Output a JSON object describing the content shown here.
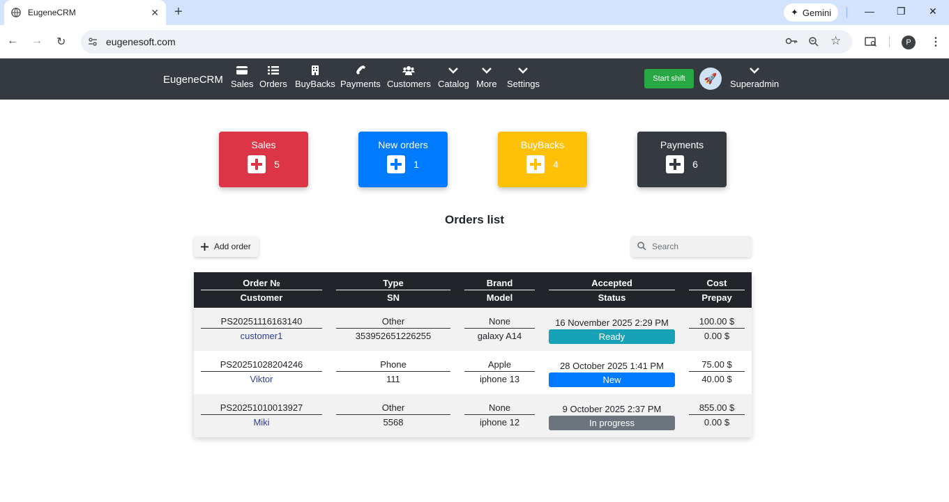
{
  "browser": {
    "tab_title": "EugeneCRM",
    "gemini_label": "Gemini",
    "url": "eugenesoft.com",
    "profile_initial": "P"
  },
  "navbar": {
    "brand": "EugeneCRM",
    "items": [
      {
        "label": "Sales",
        "icon": "card-icon"
      },
      {
        "label": "Orders",
        "icon": "list-icon"
      },
      {
        "label": "BuyBacks",
        "icon": "building-icon"
      },
      {
        "label": "Payments",
        "icon": "phone-icon"
      },
      {
        "label": "Customers",
        "icon": "users-icon"
      },
      {
        "label": "Catalog",
        "icon": "chevron-down-icon"
      },
      {
        "label": "More",
        "icon": "chevron-down-icon"
      },
      {
        "label": "Settings",
        "icon": "chevron-down-icon"
      }
    ],
    "start_shift": "Start shift",
    "user": "Superadmin"
  },
  "cards": [
    {
      "title": "Sales",
      "count": "5",
      "color": "#dc3545"
    },
    {
      "title": "New orders",
      "count": "1",
      "color": "#007bff"
    },
    {
      "title": "BuyBacks",
      "count": "4",
      "color": "#ffc107"
    },
    {
      "title": "Payments",
      "count": "6",
      "color": "#343a40"
    }
  ],
  "orders": {
    "heading": "Orders list",
    "add_label": "Add order",
    "search_placeholder": "Search",
    "headers": [
      {
        "top": "Order №",
        "bottom": "Customer"
      },
      {
        "top": "Type",
        "bottom": "SN"
      },
      {
        "top": "Brand",
        "bottom": "Model"
      },
      {
        "top": "Accepted",
        "bottom": "Status"
      },
      {
        "top": "Cost",
        "bottom": "Prepay"
      }
    ],
    "rows": [
      {
        "order_no": "PS20251116163140",
        "customer": "customer1",
        "type": "Other",
        "sn": "353952651226255",
        "brand": "None",
        "model": "galaxy A14",
        "accepted": "16 November 2025 2:29 PM",
        "status": "Ready",
        "status_color": "#17a2b8",
        "cost": "100.00 $",
        "prepay": "0.00 $"
      },
      {
        "order_no": "PS20251028204246",
        "customer": "Viktor",
        "type": "Phone",
        "sn": "111",
        "brand": "Apple",
        "model": "iphone 13",
        "accepted": "28 October 2025 1:41 PM",
        "status": "New",
        "status_color": "#007bff",
        "cost": "75.00 $",
        "prepay": "40.00 $"
      },
      {
        "order_no": "PS20251010013927",
        "customer": "Miki",
        "type": "Other",
        "sn": "5568",
        "brand": "None",
        "model": "iphone 12",
        "accepted": "9 October 2025 2:37 PM",
        "status": "In progress",
        "status_color": "#6c757d",
        "cost": "855.00 $",
        "prepay": "0.00 $"
      }
    ]
  }
}
